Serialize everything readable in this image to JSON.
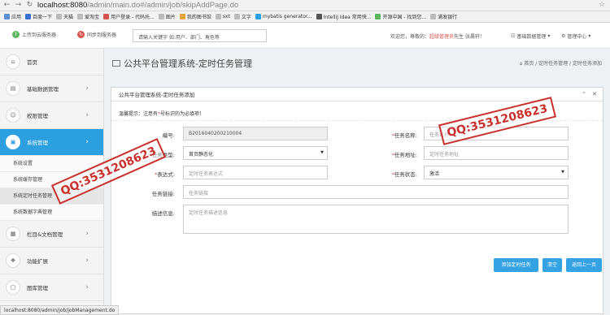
{
  "browser": {
    "url_host": "localhost:8080",
    "url_path": "/admin/main.do#/admin/job/skipAddPage.do",
    "bookmarks": [
      "应用",
      "百度一下",
      "天猫",
      "爱淘宝",
      "用户登录 - 代码托...",
      "图片",
      "我的图书馆",
      "sxt",
      "文字",
      "mybatis generator...",
      "IntelliJ Idea 常用快...",
      "开源中国 - 找到您...",
      "浦发银行"
    ]
  },
  "header": {
    "upload_label": "上传到云服务器",
    "sync_label": "同步到服务器",
    "search_placeholder": "请输入关键字 如:用户、部门、角色等",
    "welcome_prefix": "欢迎您，尊敬的：",
    "welcome_role": "超级管理员",
    "welcome_suffix": "先生 张晨轩！",
    "menu_basic": "基础数据管理",
    "menu_center": "管理中心"
  },
  "sidebar": {
    "items": [
      {
        "label": "首页",
        "icon": "home-icon"
      },
      {
        "label": "基础数据管理",
        "icon": "file-icon"
      },
      {
        "label": "权限管理",
        "icon": "user-icon"
      },
      {
        "label": "系统管理",
        "icon": "monitor-icon"
      }
    ],
    "sub_items": [
      "系统设置",
      "系统缓存管理",
      "系统定时任务管理",
      "系统数据字典管理"
    ],
    "items_after": [
      {
        "label": "栏目&文档管理",
        "icon": "doc-icon"
      },
      {
        "label": "功能扩展",
        "icon": "puzzle-icon"
      },
      {
        "label": "图库管理",
        "icon": "image-icon"
      }
    ]
  },
  "page": {
    "title": "公共平台管理系统-定时任务管理",
    "breadcrumb": "首页 / 定时任务管理 / 定时任务添加"
  },
  "panel": {
    "title": "公共平台管理系统-定时任务添加",
    "tip_prefix": "温馨提示：注意有",
    "tip_star": "*",
    "tip_suffix": "号标识的为必填项！",
    "fields": {
      "code_label": "编号:",
      "code_value": "B2016040200210004",
      "name_label": "任务名称:",
      "name_placeholder": "任务名称",
      "type_label": "任务类型:",
      "type_value": "首页静态化",
      "url_label": "任务地址:",
      "url_placeholder": "定时任务地址",
      "expr_label": "表达式:",
      "expr_placeholder": "定时任务表达式",
      "status_label": "任务状态:",
      "status_value": "激活",
      "link_label": "任务链接:",
      "link_placeholder": "任务链接",
      "desc_label": "描述信息:",
      "desc_placeholder": "定时任务描述信息"
    },
    "buttons": {
      "add": "添加定时任务",
      "clear": "清空",
      "back": "返回上一页"
    }
  },
  "stamps": [
    "QQ:3531208623",
    "QQ:3531208623"
  ],
  "statusbar": "localhost:8080/admin/job/jobManagement.do",
  "colors": {
    "accent": "#2b9fe0",
    "button": "#35a2e3",
    "required": "#d9534f",
    "stamp": "#c9302c"
  }
}
